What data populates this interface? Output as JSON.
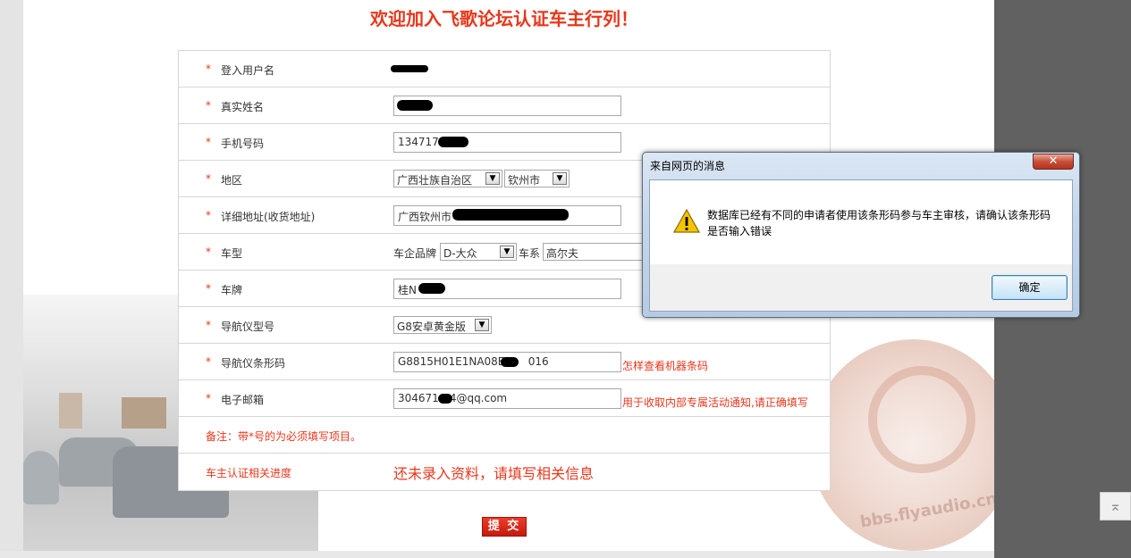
{
  "page": {
    "title": "欢迎加入飞歌论坛认证车主行列！"
  },
  "form": {
    "required_mark": "*",
    "username": {
      "label": "登入用户名",
      "value": ""
    },
    "real_name": {
      "label": "真实姓名",
      "value": ""
    },
    "phone": {
      "label": "手机号码",
      "value": "1347172"
    },
    "region": {
      "label": "地区",
      "province": "广西壮族自治区",
      "city": "钦州市"
    },
    "address": {
      "label": "详细地址(收货地址)",
      "value": "广西钦州市"
    },
    "car_model": {
      "label": "车型",
      "brand_label": "车企品牌",
      "brand": "D-大众",
      "series_label": "车系",
      "series": "高尔夫"
    },
    "plate": {
      "label": "车牌",
      "value": "桂N"
    },
    "nav_model": {
      "label": "导航仪型号",
      "value": "G8安卓黄金版"
    },
    "nav_barcode": {
      "label": "导航仪条形码",
      "value_prefix": "G8815H01E1NA08EC",
      "value_suffix": "016",
      "hint": "怎样查看机器条码"
    },
    "email": {
      "label": "电子邮箱",
      "value_prefix": "304671",
      "value_suffix": "4@qq.com",
      "hint": "用于收取内部专属活动通知,请正确填写"
    },
    "note": "备注：带*号的为必须填写项目。",
    "progress": {
      "label": "车主认证相关进度",
      "value": "还未录入资料，请填写相关信息"
    },
    "submit_label": "提 交"
  },
  "dialog": {
    "title": "来自网页的消息",
    "close_label": "✕",
    "message": "数据库已经有不同的申请者使用该条形码参与车主审核，请确认该条形码是否输入错误",
    "ok_label": "确定",
    "icon": "warning-icon"
  },
  "background": {
    "logo_text": "bbs.flyaudio.cn"
  },
  "scroll_top": {
    "icon": "scroll-top-icon",
    "glyph": "⌅"
  }
}
